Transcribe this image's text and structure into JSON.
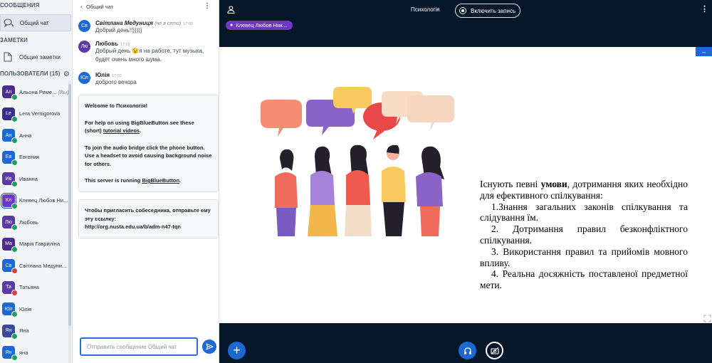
{
  "sidebar": {
    "messages_title": "СООБЩЕНИЯ",
    "public_chat_label": "Общий чат",
    "notes_title": "ЗАМЕТКИ",
    "shared_notes_label": "Общие заметки",
    "users_title": "ПОЛЬЗОВАТЕЛИ (15)",
    "users": [
      {
        "initials": "Ал",
        "name": "Альона Реме...",
        "suffix": "(Вы)",
        "color": "#4b2d8c"
      },
      {
        "initials": "Le",
        "name": "Lera Vernigorova",
        "suffix": "",
        "color": "#3b2e8a"
      },
      {
        "initials": "Ан",
        "name": "Анна",
        "suffix": "",
        "color": "#1c69d4"
      },
      {
        "initials": "Ев",
        "name": "Евгения",
        "suffix": "",
        "color": "#1c69d4"
      },
      {
        "initials": "Ив",
        "name": "Иванна",
        "suffix": "",
        "color": "#5b3aa8"
      },
      {
        "initials": "Кл",
        "name": "Клевец Любов Ни...",
        "suffix": "",
        "color": "#6e37c8"
      },
      {
        "initials": "Лю",
        "name": "Любовь",
        "suffix": "",
        "color": "#5b3aa8"
      },
      {
        "initials": "Ма",
        "name": "Марія Гавриліна",
        "suffix": "",
        "color": "#4b2d8c"
      },
      {
        "initials": "Св",
        "name": "Світлана Медуни...",
        "suffix": "",
        "color": "#1c69d4"
      },
      {
        "initials": "Та",
        "name": "Татьяна",
        "suffix": "",
        "color": "#5b3aa8"
      },
      {
        "initials": "Юл",
        "name": "Юлія",
        "suffix": "",
        "color": "#1c69d4"
      },
      {
        "initials": "Ян",
        "name": "Яна",
        "suffix": "",
        "color": "#3b4a9c"
      },
      {
        "initials": "Ян",
        "name": "яна",
        "suffix": "",
        "color": "#1c69d4"
      }
    ]
  },
  "chat": {
    "header_title": "Общий чат",
    "messages": [
      {
        "initials": "Св",
        "name": "Світлана Медуниця",
        "status": "(не в сети)",
        "time": "17:00",
        "text": "Добрий день!!)))))",
        "color": "#1c69d4"
      },
      {
        "initials": "Лю",
        "name": "Любовь",
        "status": "",
        "time": "17:02",
        "text": "Добрый день 😉я на работе, тут музыка, будет очень много шума.",
        "color": "#5b3aa8"
      },
      {
        "initials": "Юл",
        "name": "Юлія",
        "status": "",
        "time": "17:02",
        "text": "доброго вечора",
        "color": "#1c69d4"
      }
    ],
    "welcome": {
      "line1_prefix": "Welcome to ",
      "line1_bold": "Психологія",
      "line1_suffix": "!",
      "line2_prefix": "For help on using BigBlueButton see these (short) ",
      "line2_link": "tutorial videos",
      "line2_suffix": ".",
      "line3": "To join the audio bridge click the phone button. Use a headset to avoid causing background noise for others.",
      "line4_prefix": "This server is running ",
      "line4_link": "BigBlueButton",
      "line4_suffix": "."
    },
    "invite": {
      "text": "Чтобы пригласить собеседника, отправьте ему эту ссылку:",
      "link": "http://org.nusta.edu.ua/b/adm-n47-tqn"
    },
    "input_placeholder": "Отправить сообщение Общий чат"
  },
  "main": {
    "meeting_title": "Психологія",
    "record_label": "Включить запись",
    "talker_name": "Клевец Любов Ник...",
    "slide": {
      "para1_prefix": "Існують певні ",
      "para1_bold": "умови",
      "para1_suffix": ", дотримання яких необхідно для ефективного спілкування:",
      "items": [
        "1.Знання загальних законів спілкування та слідування їм.",
        "2. Дотримання правил безконфліктного спілкування.",
        "3. Використання правил та прийомів мовного впливу.",
        "4. Реальна досяжність поставленої предметної мети."
      ]
    }
  },
  "colors": {
    "accent": "#1c69d4",
    "dark_bg": "#06172a",
    "talker": "#6e37c8",
    "online": "#17a25a",
    "muted": "#e03a3a"
  }
}
